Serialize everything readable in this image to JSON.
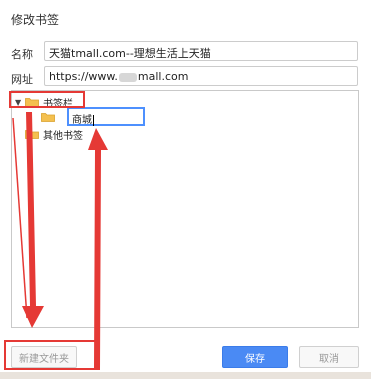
{
  "dialog": {
    "title": "修改书签"
  },
  "fields": {
    "name_label": "名称",
    "name_value": "天猫tmall.com--理想生活上天猫",
    "url_label": "网址",
    "url_prefix": "https://www.",
    "url_suffix": "mall.com"
  },
  "tree": {
    "items": [
      {
        "label": "书签栏",
        "expanded": true
      },
      {
        "label": "其他书签",
        "expanded": false
      }
    ],
    "new_folder_edit_value": "商城"
  },
  "buttons": {
    "new_folder": "新建文件夹",
    "save": "保存",
    "cancel": "取消"
  },
  "colors": {
    "accent": "#4a8af4",
    "annotation_red": "#e53935",
    "folder": "#f4c04f"
  },
  "icons": {
    "expand": "triangle-down-icon",
    "folder": "folder-icon"
  }
}
